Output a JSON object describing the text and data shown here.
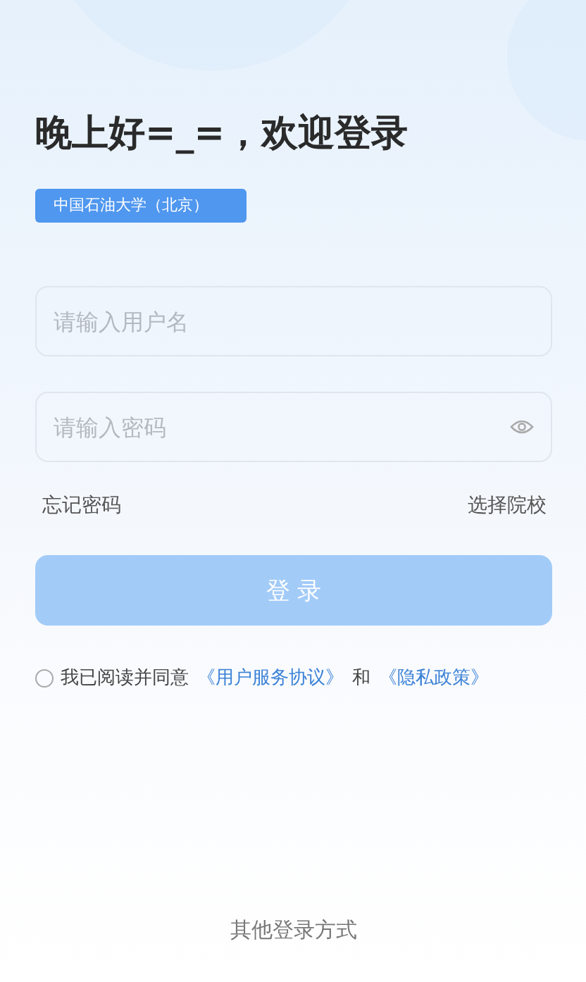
{
  "greeting": "晚上好=_=，欢迎登录",
  "school_badge": "中国石油大学（北京）",
  "username": {
    "placeholder": "请输入用户名"
  },
  "password": {
    "placeholder": "请输入密码"
  },
  "links": [
    "忘记密码",
    "选择院校"
  ],
  "login_button": {
    "label": "登 录",
    "disabled": true
  },
  "agreement": {
    "checked": false,
    "segments": [
      {
        "kind": "text",
        "text": "我已阅读并同意"
      },
      {
        "kind": "link",
        "text": "《用户服务协议》"
      },
      {
        "kind": "text",
        "text": "和"
      },
      {
        "kind": "link",
        "text": "《隐私政策》"
      }
    ]
  },
  "other_login": "其他登录方式"
}
